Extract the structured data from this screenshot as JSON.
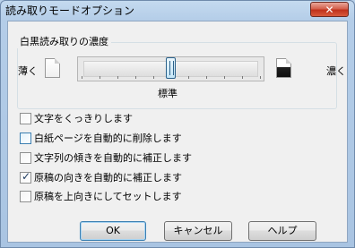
{
  "window": {
    "title": "読み取りモードオプション",
    "close_label": "✕"
  },
  "density": {
    "group_label": "白黒読み取りの濃度",
    "light_label": "薄く",
    "dark_label": "濃く",
    "light_icon": "light-document-icon",
    "dark_icon": "dark-document-icon",
    "current_label": "標準",
    "value_fraction": 0.5
  },
  "options": [
    {
      "label": "文字をくっきりします",
      "checked": false
    },
    {
      "label": "白紙ページを自動的に削除します",
      "checked": false
    },
    {
      "label": "文字列の傾きを自動的に補正します",
      "checked": false
    },
    {
      "label": "原稿の向きを自動的に補正します",
      "checked": true
    },
    {
      "label": "原稿を上向きにしてセットします",
      "checked": false
    }
  ],
  "buttons": {
    "ok": "OK",
    "cancel": "キャンセル",
    "help": "ヘルプ"
  },
  "colors": {
    "title_bar": "#b4cde8",
    "close_button": "#c0321c",
    "dialog_background": "#f0f0f0",
    "focus_blue": "#3c7fb1"
  }
}
